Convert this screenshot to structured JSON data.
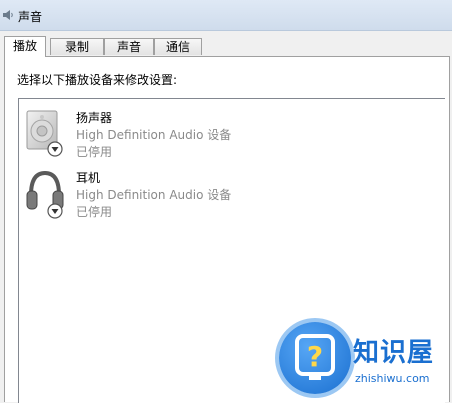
{
  "window": {
    "title": "声音"
  },
  "tabs": [
    {
      "label": "播放",
      "active": true
    },
    {
      "label": "录制",
      "active": false
    },
    {
      "label": "声音",
      "active": false
    },
    {
      "label": "通信",
      "active": false
    }
  ],
  "instruction": "选择以下播放设备来修改设置:",
  "devices": [
    {
      "name": "扬声器",
      "description": "High Definition Audio 设备",
      "status": "已停用",
      "icon": "speaker-icon"
    },
    {
      "name": "耳机",
      "description": "High Definition Audio 设备",
      "status": "已停用",
      "icon": "headphones-icon"
    }
  ],
  "watermark": {
    "brand": "知识屋",
    "domain": "zhishiwu.com",
    "icon": "question-mark-icon"
  },
  "colors": {
    "accent": "#1a6fd0",
    "disabled_text": "#8a8a8a"
  }
}
